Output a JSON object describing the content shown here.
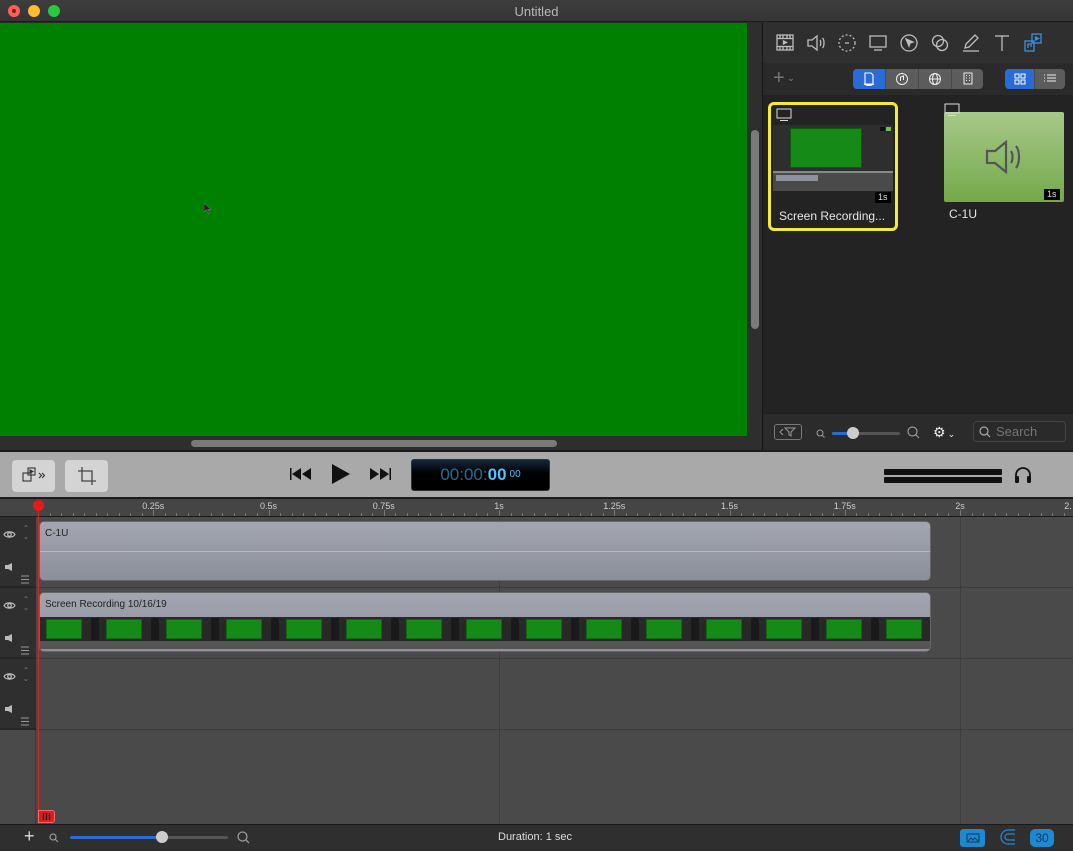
{
  "window": {
    "title": "Untitled"
  },
  "media_panel": {
    "toolbar_icons": [
      "media-icon",
      "audio-icon",
      "animation-icon",
      "screen-icon",
      "cursor-icon",
      "transitions-icon",
      "annotation-icon",
      "text-icon",
      "library-icon"
    ],
    "active_toolbar_icon": "library-icon",
    "source_tabs": [
      "document-tab",
      "music-tab",
      "web-tab",
      "table-tab"
    ],
    "active_source_tab": "document-tab",
    "view_modes": [
      "grid-view",
      "list-view"
    ],
    "active_view_mode": "grid-view",
    "items": [
      {
        "label": "Screen Recording...",
        "duration": "1s",
        "selected": true
      },
      {
        "label": "C-1U",
        "duration": "1s",
        "selected": false
      }
    ],
    "search": {
      "placeholder": "Search",
      "value": ""
    },
    "thumb_zoom": 0.3
  },
  "transport": {
    "timecode": {
      "hms": "00:00:",
      "seconds": "00",
      "frames": "00"
    },
    "volume_level": 1.0
  },
  "ruler": {
    "labels": [
      "0.25s",
      "0.5s",
      "0.75s",
      "1s",
      "1.25s",
      "1.5s",
      "1.75s",
      "2s",
      "2."
    ]
  },
  "tracks": [
    {
      "clip_title": "C-1U"
    },
    {
      "clip_title": "Screen Recording 10/16/19"
    },
    {
      "clip_title": ""
    }
  ],
  "statusbar": {
    "duration": "Duration: 1 sec",
    "timeline_zoom": 0.58,
    "fps": "30"
  },
  "colors": {
    "canvas": "#008000",
    "accent": "#2a6bd5",
    "selection": "#f5e93a",
    "playhead": "#e21c1c"
  }
}
